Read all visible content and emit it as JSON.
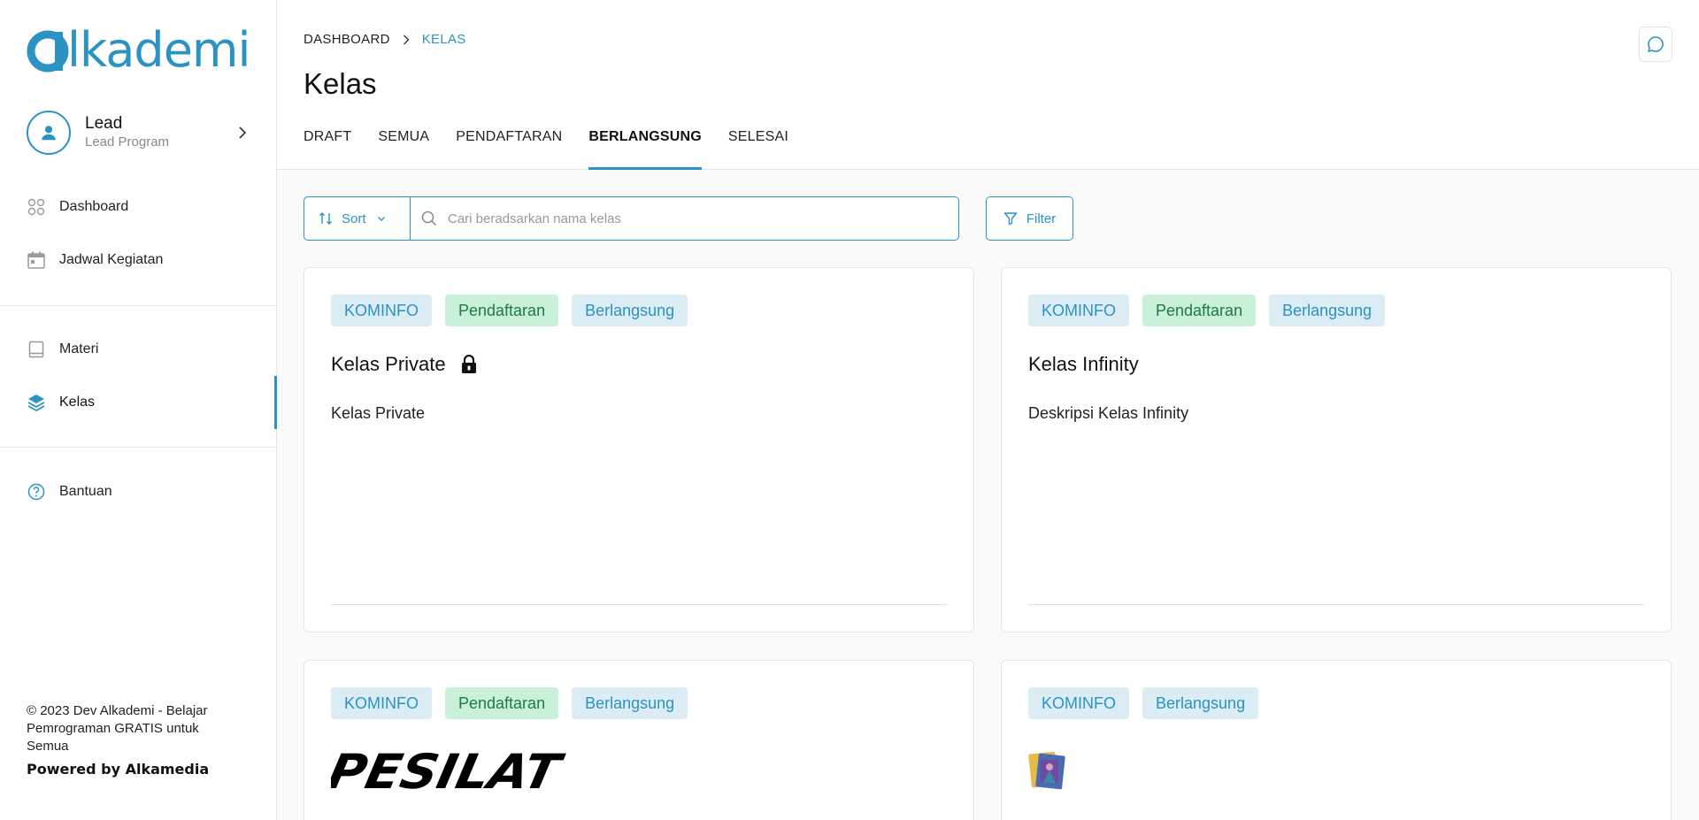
{
  "app": {
    "logo_text": "lkademi"
  },
  "user": {
    "name": "Lead",
    "role": "Lead Program"
  },
  "sidebar": {
    "items": [
      {
        "label": "Dashboard",
        "icon": "dashboard-grid-icon"
      },
      {
        "label": "Jadwal Kegiatan",
        "icon": "calendar-icon"
      },
      {
        "label": "Materi",
        "icon": "book-icon"
      },
      {
        "label": "Kelas",
        "icon": "layers-icon",
        "active": true
      },
      {
        "label": "Bantuan",
        "icon": "help-circle-icon"
      }
    ],
    "footer": {
      "copyright": "© 2023 Dev Alkademi - Belajar Pemrograman GRATIS untuk Semua",
      "powered": "Powered by Alkamedia"
    }
  },
  "breadcrumb": {
    "root": "DASHBOARD",
    "current": "KELAS"
  },
  "page": {
    "title": "Kelas"
  },
  "tabs": [
    {
      "label": "DRAFT"
    },
    {
      "label": "SEMUA"
    },
    {
      "label": "PENDAFTARAN"
    },
    {
      "label": "BERLANGSUNG",
      "active": true
    },
    {
      "label": "SELESAI"
    }
  ],
  "toolbar": {
    "sort_label": "Sort",
    "search_placeholder": "Cari beradsarkan nama kelas",
    "filter_label": "Filter"
  },
  "cards": [
    {
      "badges": [
        "KOMINFO",
        "Pendaftaran",
        "Berlangsung"
      ],
      "title": "Kelas Private",
      "locked": true,
      "description": "Kelas Private"
    },
    {
      "badges": [
        "KOMINFO",
        "Pendaftaran",
        "Berlangsung"
      ],
      "title": "Kelas Infinity",
      "locked": false,
      "description": "Deskripsi Kelas Infinity"
    },
    {
      "badges": [
        "KOMINFO",
        "Pendaftaran",
        "Berlangsung"
      ],
      "logo_text": "PESILAT"
    },
    {
      "badges": [
        "KOMINFO",
        "Berlangsung"
      ]
    }
  ],
  "colors": {
    "accent": "#2a93c4",
    "green_badge_bg": "#c9f0d8",
    "blue_badge_bg": "#dcecf5"
  }
}
